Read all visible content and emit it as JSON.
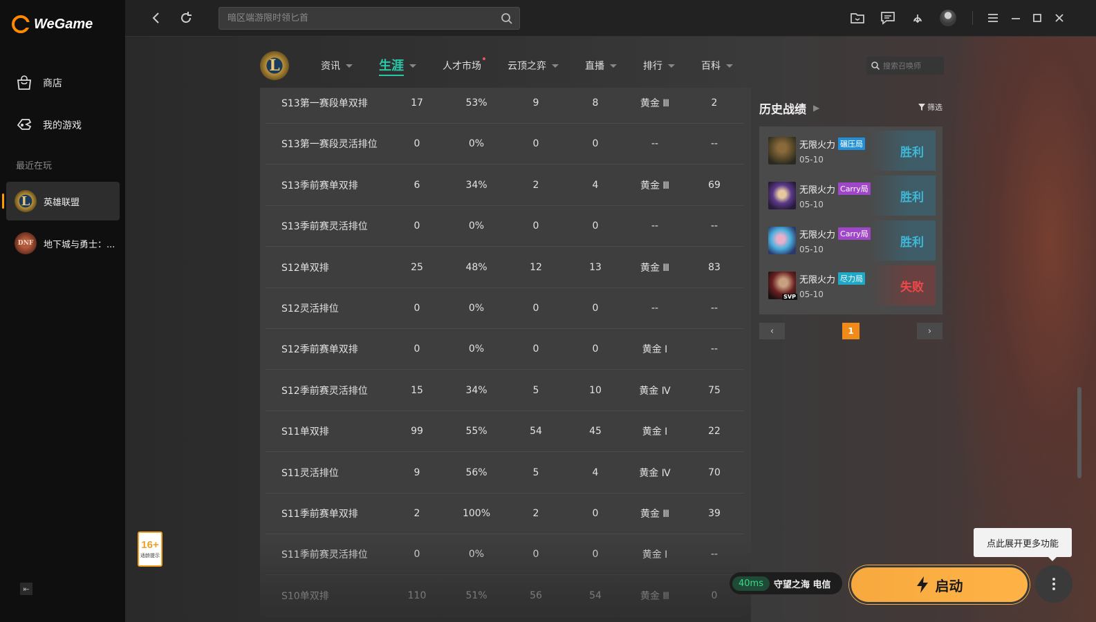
{
  "app": {
    "brand": "WeGame"
  },
  "sidebar": {
    "nav": [
      {
        "label": "商店",
        "icon": "shop-bag-icon"
      },
      {
        "label": "我的游戏",
        "icon": "gamepad-icon"
      }
    ],
    "recent_label": "最近在玩",
    "games": [
      {
        "label": "英雄联盟",
        "icon": "lol-game-icon",
        "active": true
      },
      {
        "label": "地下城与勇士：...",
        "icon": "dnf-game-icon",
        "active": false
      }
    ],
    "age_badge": {
      "num": "16+",
      "sub": "适龄提示"
    },
    "collapse_icon": "collapse-sidebar-icon"
  },
  "topbar": {
    "search_placeholder": "暗区端游限时领匕首",
    "icons": [
      "back-arrow-icon",
      "refresh-icon",
      "search-icon",
      "folder-icon",
      "message-icon",
      "download-icon",
      "user-avatar",
      "menu-icon",
      "minimize-icon",
      "maximize-icon",
      "close-icon"
    ]
  },
  "subnav": {
    "logo_letter": "L",
    "tabs": [
      {
        "label": "资讯",
        "active": false,
        "dot": false
      },
      {
        "label": "生涯",
        "active": true,
        "dot": false
      },
      {
        "label": "人才市场",
        "active": false,
        "dot": true
      },
      {
        "label": "云顶之弈",
        "active": false,
        "dot": false
      },
      {
        "label": "直播",
        "active": false,
        "dot": false
      },
      {
        "label": "排行",
        "active": false,
        "dot": false
      },
      {
        "label": "百科",
        "active": false,
        "dot": false
      }
    ],
    "summoner_search_placeholder": "搜索召唤师"
  },
  "ranked_table": {
    "rows": [
      [
        "S13第一赛段单双排",
        "17",
        "53%",
        "9",
        "8",
        "黄金 Ⅲ",
        "2"
      ],
      [
        "S13第一赛段灵活排位",
        "0",
        "0%",
        "0",
        "0",
        "--",
        "--"
      ],
      [
        "S13季前赛单双排",
        "6",
        "34%",
        "2",
        "4",
        "黄金 Ⅲ",
        "69"
      ],
      [
        "S13季前赛灵活排位",
        "0",
        "0%",
        "0",
        "0",
        "--",
        "--"
      ],
      [
        "S12单双排",
        "25",
        "48%",
        "12",
        "13",
        "黄金 Ⅲ",
        "83"
      ],
      [
        "S12灵活排位",
        "0",
        "0%",
        "0",
        "0",
        "--",
        "--"
      ],
      [
        "S12季前赛单双排",
        "0",
        "0%",
        "0",
        "0",
        "黄金 Ⅰ",
        "--"
      ],
      [
        "S12季前赛灵活排位",
        "15",
        "34%",
        "5",
        "10",
        "黄金 Ⅳ",
        "75"
      ],
      [
        "S11单双排",
        "99",
        "55%",
        "54",
        "45",
        "黄金 Ⅰ",
        "22"
      ],
      [
        "S11灵活排位",
        "9",
        "56%",
        "5",
        "4",
        "黄金 Ⅳ",
        "70"
      ],
      [
        "S11季前赛单双排",
        "2",
        "100%",
        "2",
        "0",
        "黄金 Ⅲ",
        "39"
      ],
      [
        "S11季前赛灵活排位",
        "0",
        "0%",
        "0",
        "0",
        "黄金 Ⅰ",
        "--"
      ],
      [
        "S10单双排",
        "110",
        "51%",
        "56",
        "54",
        "黄金 Ⅲ",
        "0"
      ]
    ]
  },
  "history": {
    "title": "历史战绩",
    "filter_label": "筛选",
    "matches": [
      {
        "mode": "无限火力",
        "tag": "碾压局",
        "tag_color": "#2290d8",
        "date": "05-10",
        "result": "胜利",
        "win": true,
        "champ_icon": "champion-portrait-1",
        "svp": ""
      },
      {
        "mode": "无限火力",
        "tag": "Carry局",
        "tag_color": "#a046c8",
        "date": "05-10",
        "result": "胜利",
        "win": true,
        "champ_icon": "champion-portrait-2",
        "svp": ""
      },
      {
        "mode": "无限火力",
        "tag": "Carry局",
        "tag_color": "#a046c8",
        "date": "05-10",
        "result": "胜利",
        "win": true,
        "champ_icon": "champion-portrait-3",
        "svp": ""
      },
      {
        "mode": "无限火力",
        "tag": "尽力局",
        "tag_color": "#20a8c8",
        "date": "05-10",
        "result": "失败",
        "win": false,
        "champ_icon": "champion-portrait-4",
        "svp": "SVP"
      }
    ],
    "pager": {
      "current": "1"
    }
  },
  "bottom": {
    "tooltip": "点此展开更多功能",
    "ping": "40ms",
    "server": "守望之海 电信",
    "launch_label": "启动"
  }
}
